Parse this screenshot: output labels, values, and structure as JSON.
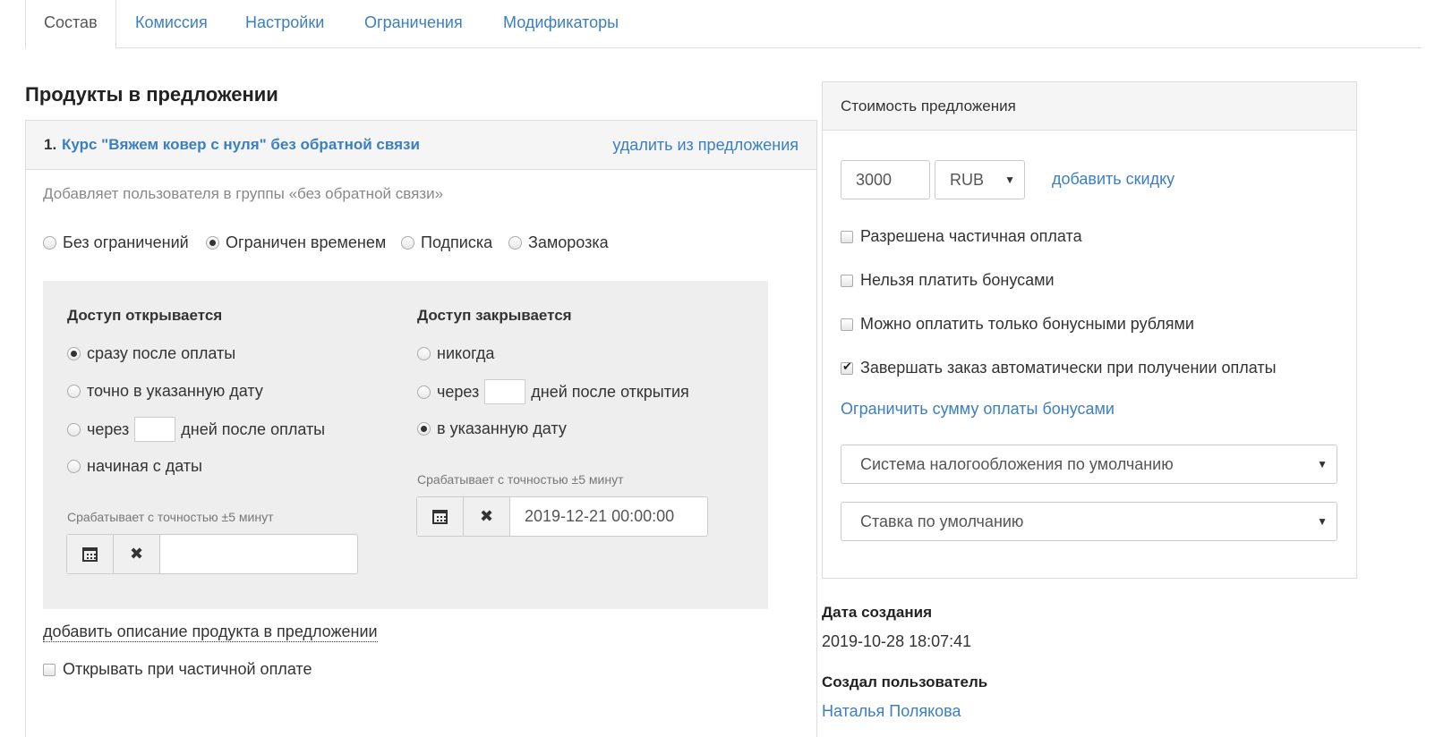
{
  "tabs": [
    "Состав",
    "Комиссия",
    "Настройки",
    "Ограничения",
    "Модификаторы"
  ],
  "section_title": "Продукты в предложении",
  "product": {
    "number": "1.",
    "name": "Курс \"Вяжем ковер с нуля\" без обратной связи",
    "remove_link": "удалить из предложения",
    "description": "Добавляет пользователя в группы «без обратной связи»",
    "access_types": [
      {
        "label": "Без ограничений",
        "checked": false
      },
      {
        "label": "Ограничен временем",
        "checked": true
      },
      {
        "label": "Подписка",
        "checked": false
      },
      {
        "label": "Заморозка",
        "checked": false
      }
    ],
    "open": {
      "title": "Доступ открывается",
      "options": {
        "immediately": "сразу после оплаты",
        "exact_date": "точно в указанную дату",
        "after_prefix": "через",
        "after_suffix": "дней после оплаты",
        "from_date": "начиная с даты"
      },
      "selected": "immediately",
      "hint": "Срабатывает с точностью ±5 минут",
      "date_value": ""
    },
    "close": {
      "title": "Доступ закрывается",
      "options": {
        "never": "никогда",
        "after_prefix": "через",
        "after_suffix": "дней после открытия",
        "on_date": "в указанную дату"
      },
      "selected": "on_date",
      "hint": "Срабатывает с точностью ±5 минут",
      "date_value": "2019-12-21 00:00:00"
    },
    "add_description_link": "добавить описание продукта в предложении",
    "open_on_partial": "Открывать при частичной оплате"
  },
  "price": {
    "title": "Стоимость предложения",
    "amount": "3000",
    "currency": "RUB",
    "add_discount": "добавить скидку",
    "checkboxes": [
      {
        "label": "Разрешена частичная оплата",
        "checked": false
      },
      {
        "label": "Нельзя платить бонусами",
        "checked": false
      },
      {
        "label": "Можно оплатить только бонусными рублями",
        "checked": false
      },
      {
        "label": "Завершать заказ автоматически при получении оплаты",
        "checked": true
      }
    ],
    "limit_bonus_link": "Ограничить сумму оплаты бонусами",
    "tax_system": "Система налогообложения по умолчанию",
    "tax_rate": "Ставка по умолчанию"
  },
  "meta": {
    "created_label": "Дата создания",
    "created_value": "2019-10-28 18:07:41",
    "creator_label": "Создал пользователь",
    "creator_value": "Наталья Полякова"
  }
}
